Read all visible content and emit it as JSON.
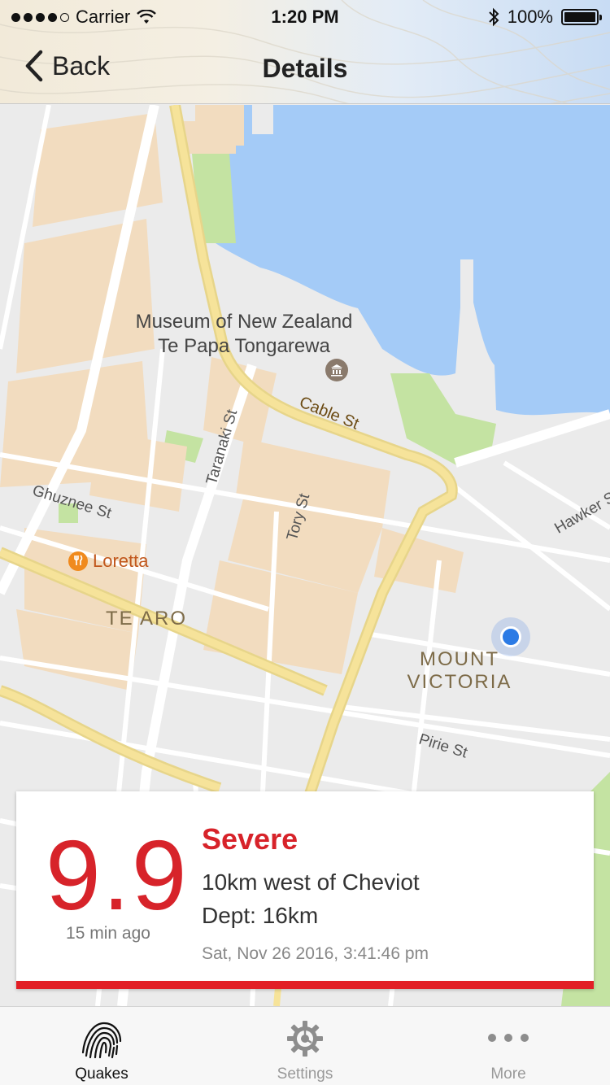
{
  "status_bar": {
    "carrier": "Carrier",
    "time": "1:20 PM",
    "battery": "100%"
  },
  "nav": {
    "back_label": "Back",
    "title": "Details"
  },
  "map": {
    "poi_museum_line1": "Museum of New Zealand",
    "poi_museum_line2": "Te Papa Tongarewa",
    "poi_restaurant": "Loretta",
    "streets": {
      "cable": "Cable St",
      "taranaki": "Taranaki St",
      "ghuznee": "Ghuznee St",
      "tory": "Tory St",
      "hawker": "Hawker St",
      "pirie": "Pirie St"
    },
    "areas": {
      "te_aro": "TE ARO",
      "mount_victoria_line1": "MOUNT",
      "mount_victoria_line2": "VICTORIA"
    }
  },
  "quake": {
    "magnitude_int": "9",
    "magnitude_dec": "9",
    "relative_time": "15 min ago",
    "severity": "Severe",
    "location": "10km west of Cheviot",
    "depth": "Dept: 16km",
    "timestamp": "Sat, Nov 26 2016, 3:41:46 pm"
  },
  "colors": {
    "severity_red": "#d7232a",
    "accent_bar": "#e21f26",
    "water": "#a4cbf7",
    "buildings": "#f2dcbf",
    "roads_major": "#f6e39a",
    "parks": "#c4e3a2"
  },
  "tabs": [
    {
      "label": "Quakes",
      "icon": "fingerprint-icon",
      "active": true
    },
    {
      "label": "Settings",
      "icon": "gear-icon",
      "active": false
    },
    {
      "label": "More",
      "icon": "ellipsis-icon",
      "active": false
    }
  ]
}
